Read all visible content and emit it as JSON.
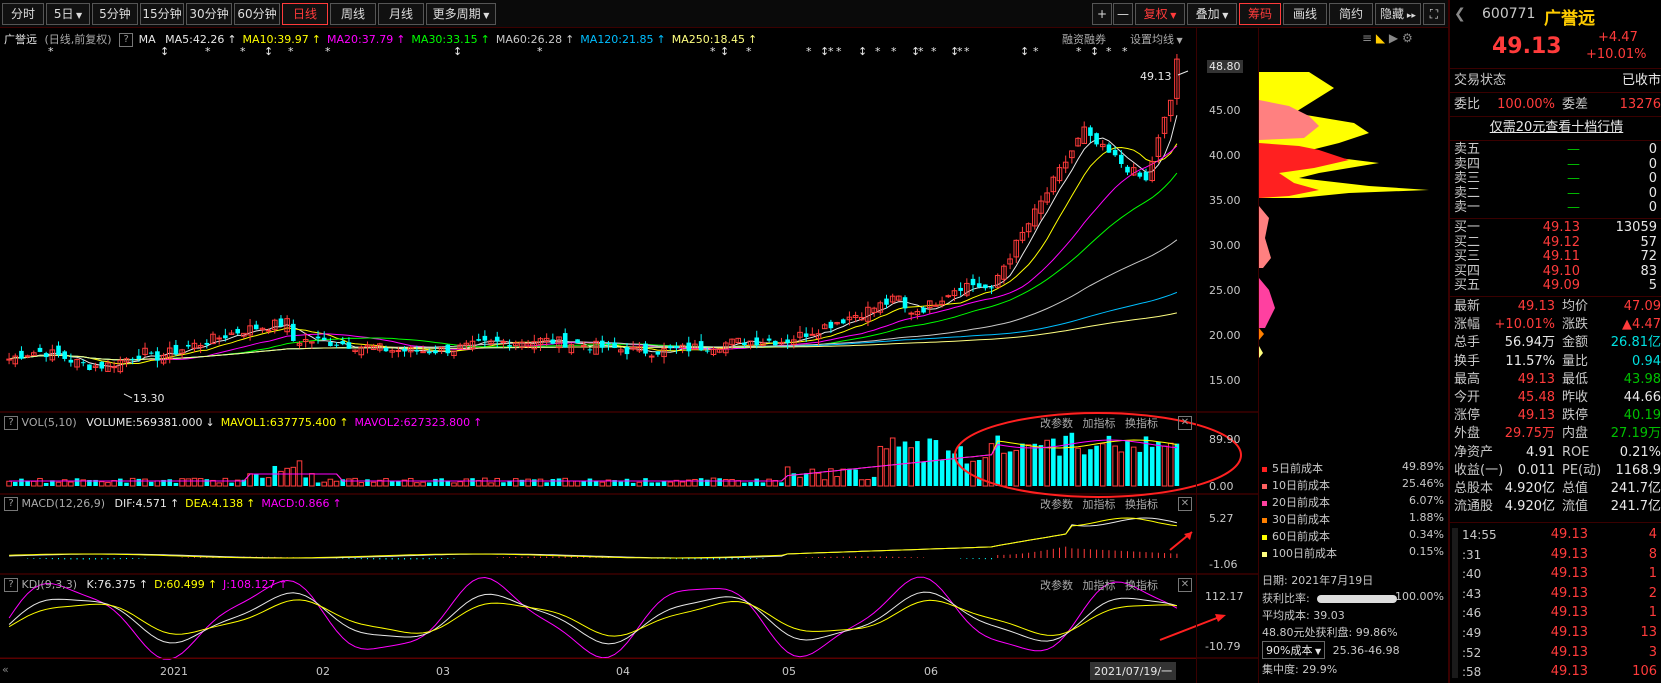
{
  "toolbar": {
    "periods": [
      "分时",
      "5日",
      "5分钟",
      "15分钟",
      "30分钟",
      "60分钟",
      "日线",
      "周线",
      "月线",
      "更多周期"
    ],
    "active_period": "日线",
    "right_buttons": [
      "复权",
      "叠加",
      "筹码",
      "画线",
      "简约",
      "隐藏"
    ],
    "plus": "+",
    "minus": "—"
  },
  "kline_header": {
    "stock": "广誉远",
    "mode": "(日线,前复权)",
    "ma_label": "MA",
    "ma_items": [
      {
        "label": "MA5:42.26",
        "color": "#e8e8e8"
      },
      {
        "label": "MA10:39.97",
        "color": "#ffff00"
      },
      {
        "label": "MA20:37.79",
        "color": "#ff00ff"
      },
      {
        "label": "MA30:33.15",
        "color": "#00ff00"
      },
      {
        "label": "MA60:26.28",
        "color": "#c8c8c8"
      },
      {
        "label": "MA120:21.85",
        "color": "#00bfff"
      },
      {
        "label": "MA250:18.45",
        "color": "#ffff80"
      }
    ],
    "rzrq": "融资融券",
    "set_ma": "设置均线"
  },
  "price_axis": [
    "48.80",
    "45.00",
    "40.00",
    "35.00",
    "30.00",
    "25.00",
    "20.00",
    "15.00"
  ],
  "last_price_tag": "49.13",
  "low_price_tag": "13.30",
  "vol_panel": {
    "name": "VOL(5,10)",
    "items": [
      {
        "label": "VOLUME:569381.000",
        "color": "#e8e8e8"
      },
      {
        "label": "MAVOL1:637775.400",
        "color": "#ffff00"
      },
      {
        "label": "MAVOL2:627323.800",
        "color": "#ff00ff"
      }
    ],
    "axis": [
      "89.90",
      "0.00"
    ],
    "btns": [
      "改参数",
      "加指标",
      "换指标"
    ]
  },
  "macd_panel": {
    "name": "MACD(12,26,9)",
    "items": [
      {
        "label": "DIF:4.571",
        "color": "#e8e8e8"
      },
      {
        "label": "DEA:4.138",
        "color": "#ffff00"
      },
      {
        "label": "MACD:0.866",
        "color": "#ff00ff"
      }
    ],
    "axis": [
      "5.27",
      "-1.06"
    ],
    "btns": [
      "改参数",
      "加指标",
      "换指标"
    ]
  },
  "kdj_panel": {
    "name": "KDJ(9,3,3)",
    "items": [
      {
        "label": "K:76.375",
        "color": "#e8e8e8"
      },
      {
        "label": "D:60.499",
        "color": "#ffff00"
      },
      {
        "label": "J:108.127",
        "color": "#ff00ff"
      }
    ],
    "axis": [
      "112.17",
      "-10.79"
    ],
    "btns": [
      "改参数",
      "加指标",
      "换指标"
    ]
  },
  "x_axis": [
    "2021",
    "02",
    "03",
    "04",
    "05",
    "06"
  ],
  "date_tag": "2021/07/19/一",
  "cost_legend": [
    {
      "label": "5日前成本",
      "value": "49.89%",
      "color": "#ff2020"
    },
    {
      "label": "10日前成本",
      "value": "25.46%",
      "color": "#ff6060"
    },
    {
      "label": "20日前成本",
      "value": "6.07%",
      "color": "#ff40a0"
    },
    {
      "label": "30日前成本",
      "value": "1.88%",
      "color": "#ff8000"
    },
    {
      "label": "60日前成本",
      "value": "0.34%",
      "color": "#ffff00"
    },
    {
      "label": "100日前成本",
      "value": "0.15%",
      "color": "#ffff80"
    }
  ],
  "cost_info": {
    "date": "日期: 2021年7月19日",
    "profit_label": "获利比率:",
    "profit_value": "100.00%",
    "profit_ratio": 1.0,
    "avg_cost": "平均成本: 39.03",
    "profit_at": "48.80元处获利盘: 99.86%",
    "range_select": "90%成本",
    "range_value": "25.36-46.98",
    "concentration": "集中度: 29.9%"
  },
  "quote": {
    "code": "600771",
    "name": "广誉远",
    "price": "49.13",
    "change": "+4.47",
    "change_pct": "+10.01%",
    "trade_status_label": "交易状态",
    "trade_status": "已收市",
    "weibi_label": "委比",
    "weibi": "100.00%",
    "weicha_label": "委差",
    "weicha": "13276",
    "ten_level": "仅需20元查看十档行情",
    "asks": [
      {
        "label": "卖五",
        "price": "—",
        "vol": "0"
      },
      {
        "label": "卖四",
        "price": "—",
        "vol": "0"
      },
      {
        "label": "卖三",
        "price": "—",
        "vol": "0"
      },
      {
        "label": "卖二",
        "price": "—",
        "vol": "0"
      },
      {
        "label": "卖一",
        "price": "—",
        "vol": "0"
      }
    ],
    "bids": [
      {
        "label": "买一",
        "price": "49.13",
        "vol": "13059"
      },
      {
        "label": "买二",
        "price": "49.12",
        "vol": "57"
      },
      {
        "label": "买三",
        "price": "49.11",
        "vol": "72"
      },
      {
        "label": "买四",
        "price": "49.10",
        "vol": "83"
      },
      {
        "label": "买五",
        "price": "49.09",
        "vol": "5"
      }
    ],
    "stats": [
      {
        "l1": "最新",
        "v1": "49.13",
        "c1": "up",
        "l2": "均价",
        "v2": "47.09",
        "c2": "up"
      },
      {
        "l1": "涨幅",
        "v1": "+10.01%",
        "c1": "up",
        "l2": "涨跌",
        "v2": "▲4.47",
        "c2": "up"
      },
      {
        "l1": "总手",
        "v1": "56.94万",
        "c1": "wht",
        "l2": "金额",
        "v2": "26.81亿",
        "c2": "dn"
      },
      {
        "l1": "换手",
        "v1": "11.57%",
        "c1": "wht",
        "l2": "量比",
        "v2": "0.94",
        "c2": "dn"
      },
      {
        "l1": "最高",
        "v1": "49.13",
        "c1": "up",
        "l2": "最低",
        "v2": "43.98",
        "c2": "eq"
      },
      {
        "l1": "今开",
        "v1": "45.48",
        "c1": "up",
        "l2": "昨收",
        "v2": "44.66",
        "c2": "wht"
      },
      {
        "l1": "涨停",
        "v1": "49.13",
        "c1": "up",
        "l2": "跌停",
        "v2": "40.19",
        "c2": "eq"
      },
      {
        "l1": "外盘",
        "v1": "29.75万",
        "c1": "up",
        "l2": "内盘",
        "v2": "27.19万",
        "c2": "eq"
      },
      {
        "l1": "净资产",
        "v1": "4.91",
        "c1": "wht",
        "l2": "ROE",
        "v2": "0.21%",
        "c2": "wht"
      },
      {
        "l1": "收益(一)",
        "v1": "0.011",
        "c1": "wht",
        "l2": "PE(动)",
        "v2": "1168.9",
        "c2": "wht"
      },
      {
        "l1": "总股本",
        "v1": "4.920亿",
        "c1": "wht",
        "l2": "总值",
        "v2": "241.7亿",
        "c2": "wht"
      },
      {
        "l1": "流通股",
        "v1": "4.920亿",
        "c1": "wht",
        "l2": "流值",
        "v2": "241.7亿",
        "c2": "wht"
      }
    ],
    "ticks": [
      {
        "t": "14:55",
        "p": "49.13",
        "v": "4",
        "vc": "up"
      },
      {
        "t": ":31",
        "p": "49.13",
        "v": "8",
        "vc": "up"
      },
      {
        "t": ":40",
        "p": "49.13",
        "v": "1",
        "vc": "up"
      },
      {
        "t": ":43",
        "p": "49.13",
        "v": "2",
        "vc": "up"
      },
      {
        "t": ":46",
        "p": "49.13",
        "v": "1",
        "vc": "up"
      },
      {
        "t": ":49",
        "p": "49.13",
        "v": "13",
        "vc": "up"
      },
      {
        "t": ":52",
        "p": "49.13",
        "v": "3",
        "vc": "up"
      },
      {
        "t": ":58",
        "p": "49.13",
        "v": "106",
        "vc": "up"
      }
    ]
  }
}
